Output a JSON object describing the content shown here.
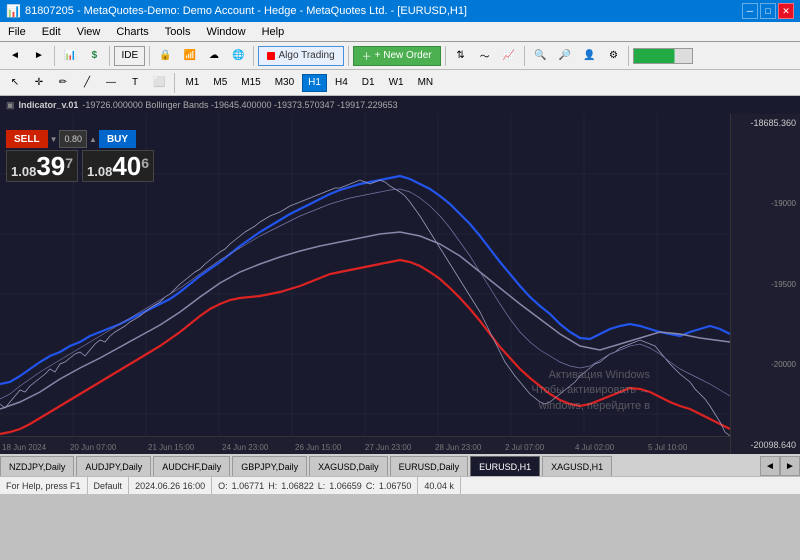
{
  "title": "81807205 - MetaQuotes-Demo: Demo Account - Hedge - MetaQuotes Ltd. - [EURUSD,H1]",
  "menu": {
    "items": [
      "File",
      "Edit",
      "View",
      "Charts",
      "Tools",
      "Window",
      "Help"
    ]
  },
  "toolbar": {
    "algo_trading": "Algo Trading",
    "new_order": "+ New Order"
  },
  "timeframes": {
    "buttons": [
      "M1",
      "M5",
      "M15",
      "M30",
      "H1",
      "H4",
      "D1",
      "W1",
      "MN"
    ],
    "active": "H1"
  },
  "chart_info": {
    "indicator": "Indicator_v.01",
    "values": "-19726.000000 Bollinger Bands -19645.400000 -19373.570347 -19917.229653"
  },
  "trade_panel": {
    "sell_label": "SELL",
    "buy_label": "BUY",
    "spread": "0.80",
    "bid_prefix": "1.08",
    "bid_large": "39",
    "bid_sup": "7",
    "ask_prefix": "1.08",
    "ask_large": "40",
    "ask_sup": "6"
  },
  "price_scale": {
    "values": [
      "-18685.360",
      "-19000",
      "-19500",
      "-20000",
      "-20098.640"
    ]
  },
  "x_axis": {
    "labels": [
      "18 Jun 2024",
      "20 Jun 07:00",
      "21 Jun 15:00",
      "24 Jun 23:00",
      "26 Jun 15:00",
      "27 Jun 23:00",
      "28 Jun 23:00",
      "2 Jul 07:00",
      "4 Jul 02:00",
      "5 Jul 10:00"
    ]
  },
  "tabs": {
    "items": [
      "NZDJPY,Daily",
      "AUDJPY,Daily",
      "AUDCHF,Daily",
      "GBPJPY,Daily",
      "XAGUSD,Daily",
      "EURUSD,Daily",
      "EURUSD,H1",
      "XAGUSD,H1"
    ],
    "active": "EURUSD,H1"
  },
  "status_bar": {
    "help": "For Help, press F1",
    "default": "Default",
    "datetime": "2024.06.26 16:00",
    "open_label": "O:",
    "open_val": "1.06771",
    "high_label": "H:",
    "high_val": "1.06822",
    "low_label": "L:",
    "low_val": "1.06659",
    "close_label": "C:",
    "close_val": "1.06750",
    "volume": "40.04 k"
  },
  "watermark": {
    "line1": "Активация Windows",
    "line2": "Чтобы активировать →",
    "line3": "windows, перейдите в"
  },
  "colors": {
    "bg_chart": "#1a1a2e",
    "blue_line": "#2255dd",
    "red_line": "#dd2222",
    "gray_line": "#888899",
    "light_gray": "#aaaacc"
  }
}
